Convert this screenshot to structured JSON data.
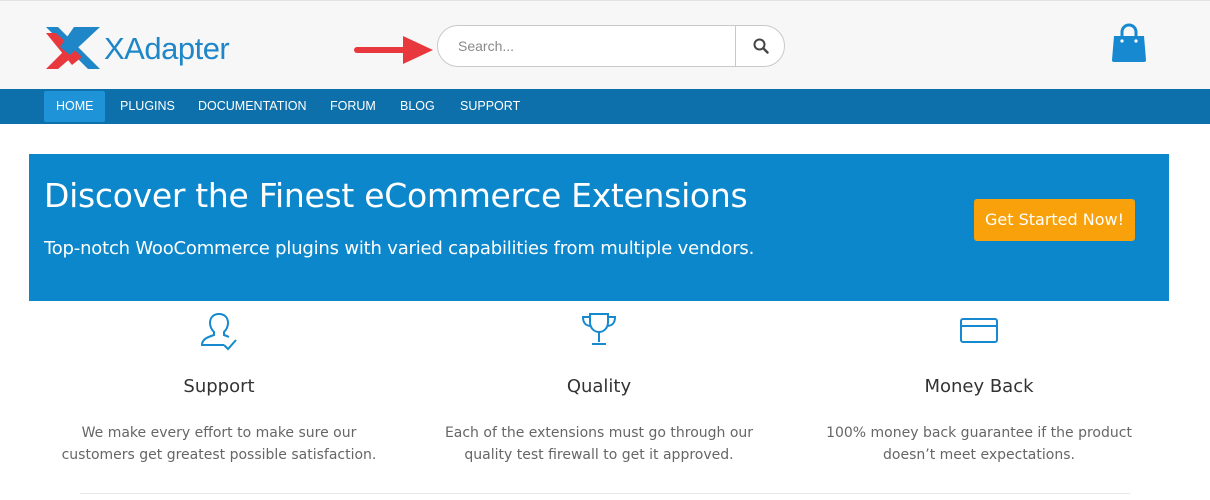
{
  "brand": {
    "name": "XAdapter",
    "logo_icon": "xadapter-logo-icon",
    "color": "#1f86c8"
  },
  "search": {
    "placeholder": "Search...",
    "value": "",
    "icon": "search-icon"
  },
  "annotation": {
    "icon": "red-arrow-icon",
    "color": "#e8383d"
  },
  "cart": {
    "icon": "shopping-bag-icon",
    "color": "#1689d1"
  },
  "nav": {
    "active_color": "#1f93d8",
    "bar_color": "#0e70aa",
    "items": [
      {
        "label": "HOME",
        "active": true
      },
      {
        "label": "PLUGINS",
        "active": false
      },
      {
        "label": "DOCUMENTATION",
        "active": false
      },
      {
        "label": "FORUM",
        "active": false
      },
      {
        "label": "BLOG",
        "active": false
      },
      {
        "label": "SUPPORT",
        "active": false
      }
    ]
  },
  "hero": {
    "title": "Discover the Finest eCommerce Extensions",
    "subtitle": "Top-notch WooCommerce plugins with varied capabilities from multiple vendors.",
    "cta_label": "Get Started Now!",
    "background": "#0c87cb",
    "cta_color": "#f8a10a"
  },
  "features": [
    {
      "icon": "user-check-icon",
      "title": "Support",
      "text": "We make every effort to make sure our customers get greatest possible satisfaction."
    },
    {
      "icon": "trophy-icon",
      "title": "Quality",
      "text": "Each of the extensions must go through our quality test firewall to get it approved."
    },
    {
      "icon": "credit-card-icon",
      "title": "Money Back",
      "text": "100% money back guarantee if the product doesn’t meet expectations."
    }
  ]
}
